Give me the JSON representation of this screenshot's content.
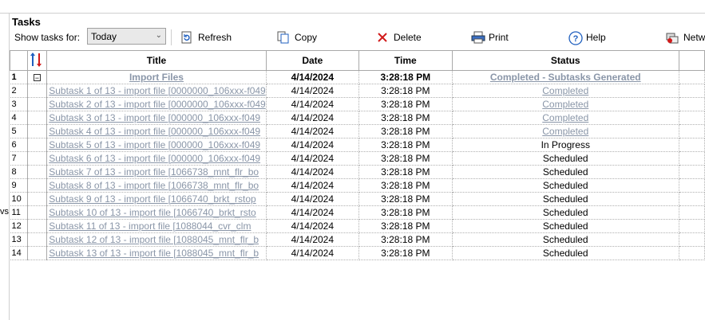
{
  "window": {
    "title": "Tasks",
    "side_text": "vs"
  },
  "toolbar": {
    "show_label": "Show tasks for:",
    "filter_value": "Today",
    "refresh_label": "Refresh",
    "copy_label": "Copy",
    "delete_label": "Delete",
    "print_label": "Print",
    "help_label": "Help",
    "network_label": "Netw"
  },
  "grid": {
    "columns": {
      "title": "Title",
      "date": "Date",
      "time": "Time",
      "status": "Status"
    },
    "rows": [
      {
        "n": "1",
        "title": "Import Files",
        "date": "4/14/2024",
        "time": "3:28:18 PM",
        "status": "Completed - Subtasks Generated"
      },
      {
        "n": "2",
        "title": "Subtask 1 of 13 - import file [0000000_106xxx-f049",
        "date": "4/14/2024",
        "time": "3:28:18 PM",
        "status": "Completed"
      },
      {
        "n": "3",
        "title": "Subtask 2 of 13 - import file [0000000_106xxx-f049",
        "date": "4/14/2024",
        "time": "3:28:18 PM",
        "status": "Completed"
      },
      {
        "n": "4",
        "title": "Subtask 3 of 13 - import file [000000_106xxx-f049",
        "date": "4/14/2024",
        "time": "3:28:18 PM",
        "status": "Completed"
      },
      {
        "n": "5",
        "title": "Subtask 4 of 13 - import file [000000_106xxx-f049",
        "date": "4/14/2024",
        "time": "3:28:18 PM",
        "status": "Completed"
      },
      {
        "n": "6",
        "title": "Subtask 5 of 13 - import file [000000_106xxx-f049",
        "date": "4/14/2024",
        "time": "3:28:18 PM",
        "status": "In Progress"
      },
      {
        "n": "7",
        "title": "Subtask 6 of 13 - import file [000000_106xxx-f049",
        "date": "4/14/2024",
        "time": "3:28:18 PM",
        "status": "Scheduled"
      },
      {
        "n": "8",
        "title": "Subtask 7 of 13 - import file [1066738_mnt_flr_bo",
        "date": "4/14/2024",
        "time": "3:28:18 PM",
        "status": "Scheduled"
      },
      {
        "n": "9",
        "title": "Subtask 8 of 13 - import file [1066738_mnt_flr_bo",
        "date": "4/14/2024",
        "time": "3:28:18 PM",
        "status": "Scheduled"
      },
      {
        "n": "10",
        "title": "Subtask 9 of 13 - import file [1066740_brkt_rstop",
        "date": "4/14/2024",
        "time": "3:28:18 PM",
        "status": "Scheduled"
      },
      {
        "n": "11",
        "title": "Subtask 10 of 13 - import file [1066740_brkt_rsto",
        "date": "4/14/2024",
        "time": "3:28:18 PM",
        "status": "Scheduled"
      },
      {
        "n": "12",
        "title": "Subtask 11 of 13 - import file [1088044_cvr_clm",
        "date": "4/14/2024",
        "time": "3:28:18 PM",
        "status": "Scheduled"
      },
      {
        "n": "13",
        "title": "Subtask 12 of 13 - import file [1088045_mnt_flr_b",
        "date": "4/14/2024",
        "time": "3:28:18 PM",
        "status": "Scheduled"
      },
      {
        "n": "14",
        "title": "Subtask 13 of 13 - import file [1088045_mnt_flr_b",
        "date": "4/14/2024",
        "time": "3:28:18 PM",
        "status": "Scheduled"
      }
    ]
  },
  "colors": {
    "link": "#8a96a8",
    "grid_border": "#a9a9a9",
    "delete_x": "#d11a1a",
    "help_blue": "#1f5fbf"
  }
}
